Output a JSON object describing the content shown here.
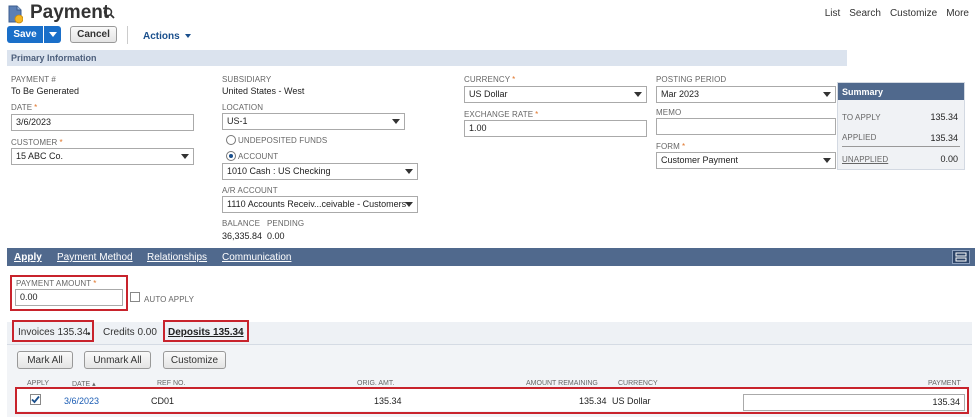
{
  "header": {
    "title": "Payment",
    "nav": [
      "List",
      "Search",
      "Customize",
      "More"
    ]
  },
  "toolbar": {
    "save_label": "Save",
    "cancel_label": "Cancel",
    "actions_label": "Actions"
  },
  "section_primary": "Primary Information",
  "fields": {
    "payment_no_label": "PAYMENT #",
    "payment_no_value": "To Be Generated",
    "date_label": "DATE",
    "date_value": "3/6/2023",
    "customer_label": "CUSTOMER",
    "customer_value": "15 ABC Co.",
    "subsidiary_label": "SUBSIDIARY",
    "subsidiary_value": "United States - West",
    "location_label": "LOCATION",
    "location_value": "US-1",
    "undeposited_label": "UNDEPOSITED FUNDS",
    "account_radio_label": "ACCOUNT",
    "account_value": "1010 Cash : US Checking",
    "ar_account_label": "A/R ACCOUNT",
    "ar_account_value": "1110 Accounts Receiv...ceivable - Customers",
    "balance_label": "BALANCE",
    "balance_value": "36,335.84",
    "pending_label": "PENDING",
    "pending_value": "0.00",
    "currency_label": "CURRENCY",
    "currency_value": "US Dollar",
    "exchange_rate_label": "EXCHANGE RATE",
    "exchange_rate_value": "1.00",
    "posting_period_label": "POSTING PERIOD",
    "posting_period_value": "Mar 2023",
    "memo_label": "MEMO",
    "memo_value": "",
    "form_label": "FORM",
    "form_value": "Customer Payment"
  },
  "summary": {
    "title": "Summary",
    "to_apply_label": "TO APPLY",
    "to_apply_value": "135.34",
    "applied_label": "APPLIED",
    "applied_value": "135.34",
    "unapplied_label": "UNAPPLIED",
    "unapplied_value": "0.00"
  },
  "tabs": [
    "Apply",
    "Payment Method",
    "Relationships",
    "Communication"
  ],
  "apply": {
    "payment_amount_label": "PAYMENT AMOUNT",
    "payment_amount_value": "0.00",
    "auto_apply_label": "AUTO APPLY",
    "subtabs": {
      "invoices": "Invoices 135.34",
      "credits": "Credits 0.00",
      "deposits": "Deposits 135.34"
    },
    "buttons": {
      "mark_all": "Mark All",
      "unmark_all": "Unmark All",
      "customize": "Customize"
    },
    "columns": {
      "apply": "APPLY",
      "date": "DATE ▴",
      "ref_no": "REF NO.",
      "orig_amt": "ORIG. AMT.",
      "amount_remaining": "AMOUNT REMAINING",
      "currency": "CURRENCY",
      "payment": "PAYMENT"
    },
    "row": {
      "checked": true,
      "date": "3/6/2023",
      "ref_no": "CD01",
      "orig_amt": "135.34",
      "amount_remaining": "135.34",
      "currency": "US Dollar",
      "payment": "135.34"
    }
  },
  "colors": {
    "primary_blue": "#1a6fc9",
    "tab_bar": "#50698d",
    "section_bg": "#dbe3ee",
    "highlight": "#c8232c"
  }
}
